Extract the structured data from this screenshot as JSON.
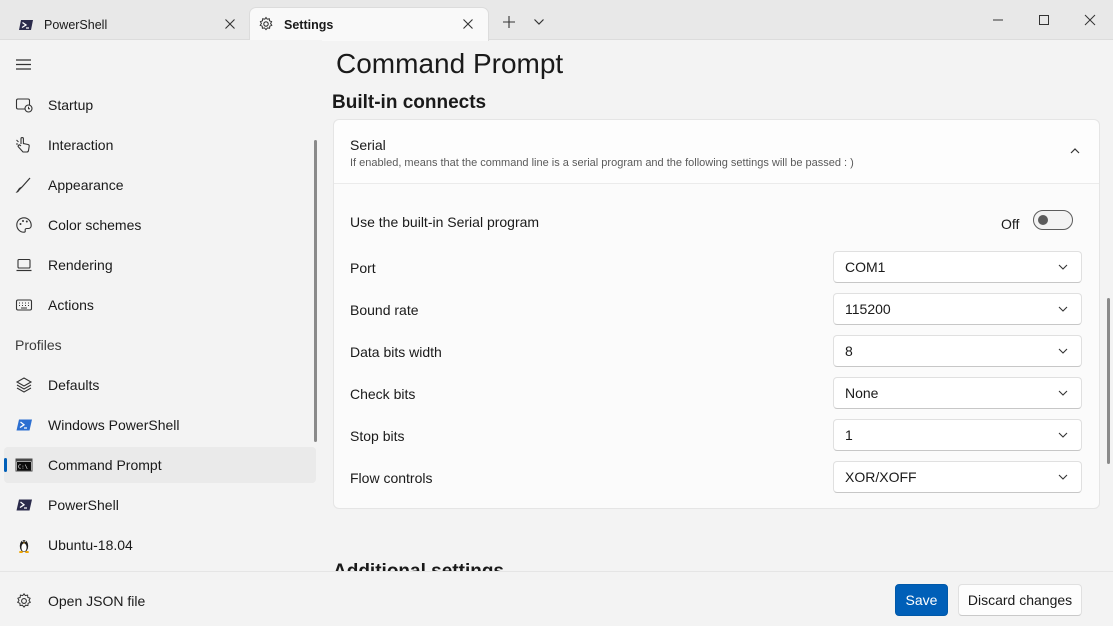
{
  "tabs": [
    {
      "label": "PowerShell",
      "icon": "powershell-icon",
      "active": false
    },
    {
      "label": "Settings",
      "icon": "gear-icon",
      "active": true
    }
  ],
  "sidebar": {
    "items": [
      {
        "label": "Startup",
        "icon": "startup-icon"
      },
      {
        "label": "Interaction",
        "icon": "interaction-icon"
      },
      {
        "label": "Appearance",
        "icon": "paintbrush-icon"
      },
      {
        "label": "Color schemes",
        "icon": "palette-icon"
      },
      {
        "label": "Rendering",
        "icon": "laptop-icon"
      },
      {
        "label": "Actions",
        "icon": "keyboard-icon"
      }
    ],
    "profiles_header": "Profiles",
    "profiles": [
      {
        "label": "Defaults",
        "icon": "layers-icon"
      },
      {
        "label": "Windows PowerShell",
        "icon": "powershell-icon"
      },
      {
        "label": "Command Prompt",
        "icon": "cmd-icon",
        "selected": true
      },
      {
        "label": "PowerShell",
        "icon": "powershell-icon"
      },
      {
        "label": "Ubuntu-18.04",
        "icon": "linux-penguin-icon"
      }
    ],
    "footer_item": {
      "label": "Open JSON file",
      "icon": "gear-icon"
    }
  },
  "main": {
    "page_title": "Command Prompt",
    "section_title": "Built-in connects",
    "card": {
      "title": "Serial",
      "description": "If enabled, means that the command line is a serial program and the following settings will be passed : )",
      "toggle_label": "Use the built-in Serial program",
      "toggle_state": "Off",
      "rows": [
        {
          "label": "Port",
          "value": "COM1"
        },
        {
          "label": "Bound rate",
          "value": "115200"
        },
        {
          "label": "Data bits width",
          "value": "8"
        },
        {
          "label": "Check bits",
          "value": "None"
        },
        {
          "label": "Stop bits",
          "value": "1"
        },
        {
          "label": "Flow controls",
          "value": "XOR/XOFF"
        }
      ]
    },
    "next_section_title": "Additional settings"
  },
  "footer": {
    "save_label": "Save",
    "discard_label": "Discard changes"
  },
  "colors": {
    "accent": "#005fb8",
    "background": "#f3f3f3",
    "card": "#fbfbfb"
  }
}
